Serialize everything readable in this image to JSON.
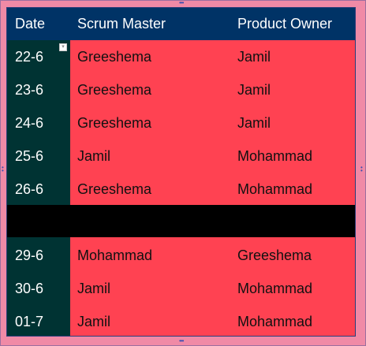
{
  "table": {
    "headers": {
      "date": "Date",
      "scrum_master": "Scrum Master",
      "product_owner": "Product Owner"
    },
    "rows": [
      {
        "date": "22-6",
        "scrum_master": "Greeshema",
        "product_owner": "Jamil"
      },
      {
        "date": "23-6",
        "scrum_master": "Greeshema",
        "product_owner": "Jamil"
      },
      {
        "date": "24-6",
        "scrum_master": "Greeshema",
        "product_owner": "Jamil"
      },
      {
        "date": "25-6",
        "scrum_master": "Jamil",
        "product_owner": "Mohammad"
      },
      {
        "date": "26-6",
        "scrum_master": "Greeshema",
        "product_owner": "Mohammad"
      },
      {
        "date": "29-6",
        "scrum_master": "Mohammad",
        "product_owner": "Greeshema"
      },
      {
        "date": "30-6",
        "scrum_master": "Jamil",
        "product_owner": "Mohammad"
      },
      {
        "date": "01-7",
        "scrum_master": "Jamil",
        "product_owner": "Mohammad"
      }
    ]
  },
  "colors": {
    "header_bg": "#003366",
    "date_col_bg": "#003333",
    "row_bg": "#ff4252",
    "frame_bg": "#f08aa6",
    "weekend_bar": "#000000"
  },
  "icons": {
    "filter": "dropdown-filter-icon",
    "resize": "resize-handle-icon"
  }
}
